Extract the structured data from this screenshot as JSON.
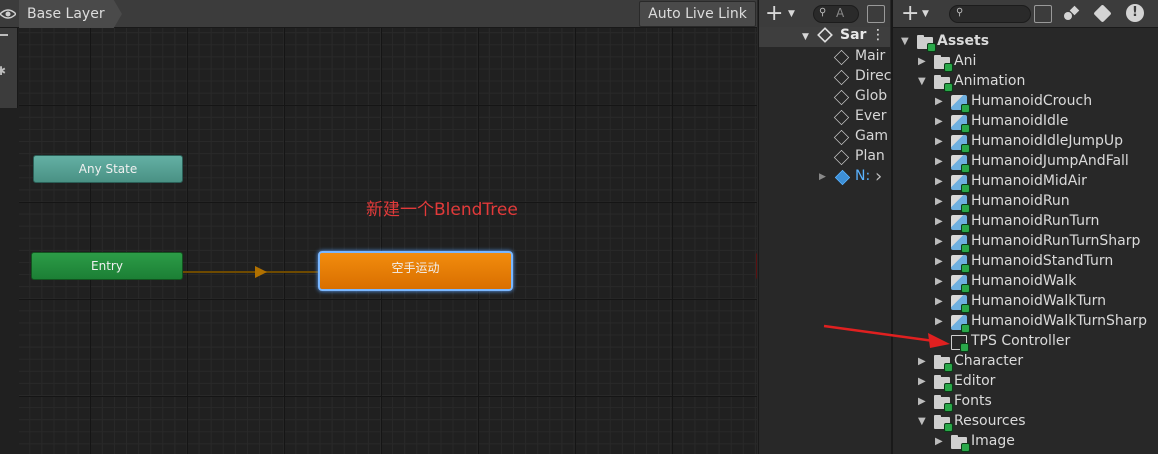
{
  "animator": {
    "breadcrumb": "Base Layer",
    "auto_live_link": "Auto Live Link",
    "nodes": {
      "any_state": "Any State",
      "entry": "Entry",
      "default_state": "空手运动"
    },
    "annotation": "新建一个BlendTree",
    "colors": {
      "any_state": "#5aa497",
      "entry": "#238f3e",
      "default_state": "#e87e05",
      "exit": "#bb2424",
      "annotation": "#e23a3a"
    }
  },
  "hierarchy": {
    "search_placeholder": "A",
    "scene": "Sar",
    "items": [
      "Mair",
      "Direc",
      "Glob",
      "Ever",
      "Gam",
      "Plan",
      "N:"
    ]
  },
  "project": {
    "tree": [
      {
        "label": "Assets",
        "level": 0,
        "expanded": true,
        "type": "folder",
        "bold": true
      },
      {
        "label": "Ani",
        "level": 1,
        "expanded": false,
        "type": "folder"
      },
      {
        "label": "Animation",
        "level": 1,
        "expanded": true,
        "type": "folder"
      },
      {
        "label": "HumanoidCrouch",
        "level": 2,
        "expanded": false,
        "type": "anim"
      },
      {
        "label": "HumanoidIdle",
        "level": 2,
        "expanded": false,
        "type": "anim"
      },
      {
        "label": "HumanoidIdleJumpUp",
        "level": 2,
        "expanded": false,
        "type": "anim"
      },
      {
        "label": "HumanoidJumpAndFall",
        "level": 2,
        "expanded": false,
        "type": "anim"
      },
      {
        "label": "HumanoidMidAir",
        "level": 2,
        "expanded": false,
        "type": "anim"
      },
      {
        "label": "HumanoidRun",
        "level": 2,
        "expanded": false,
        "type": "anim"
      },
      {
        "label": "HumanoidRunTurn",
        "level": 2,
        "expanded": false,
        "type": "anim"
      },
      {
        "label": "HumanoidRunTurnSharp",
        "level": 2,
        "expanded": false,
        "type": "anim"
      },
      {
        "label": "HumanoidStandTurn",
        "level": 2,
        "expanded": false,
        "type": "anim"
      },
      {
        "label": "HumanoidWalk",
        "level": 2,
        "expanded": false,
        "type": "anim"
      },
      {
        "label": "HumanoidWalkTurn",
        "level": 2,
        "expanded": false,
        "type": "anim"
      },
      {
        "label": "HumanoidWalkTurnSharp",
        "level": 2,
        "expanded": false,
        "type": "anim"
      },
      {
        "label": "TPS Controller",
        "level": 2,
        "expanded": null,
        "type": "controller"
      },
      {
        "label": "Character",
        "level": 1,
        "expanded": false,
        "type": "folder"
      },
      {
        "label": "Editor",
        "level": 1,
        "expanded": false,
        "type": "folder"
      },
      {
        "label": "Fonts",
        "level": 1,
        "expanded": false,
        "type": "folder"
      },
      {
        "label": "Resources",
        "level": 1,
        "expanded": true,
        "type": "folder"
      },
      {
        "label": "Image",
        "level": 2,
        "expanded": false,
        "type": "folder"
      }
    ]
  }
}
